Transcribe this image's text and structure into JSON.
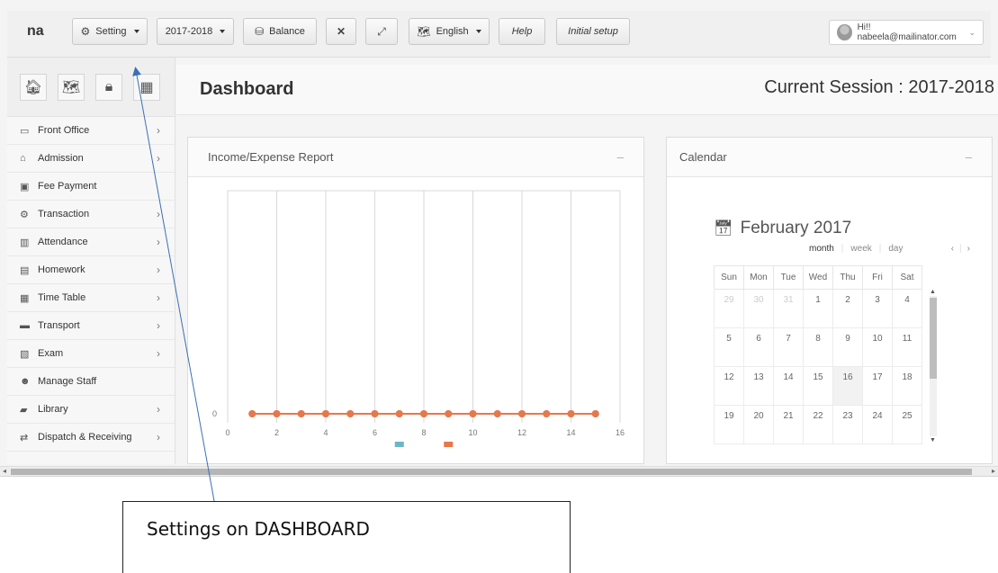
{
  "topbar": {
    "brand": "na",
    "setting_label": "Setting",
    "session_label": "2017-2018",
    "balance_label": "Balance",
    "language_label": "English",
    "help_label": "Help",
    "initial_setup_label": "Initial setup",
    "user_label": "Hi!! nabeela@mailinator.com"
  },
  "sidebar": {
    "items": [
      {
        "label": "Front Office",
        "icon": "monitor-icon"
      },
      {
        "label": "Admission",
        "icon": "graduation-cap-icon"
      },
      {
        "label": "Fee Payment",
        "icon": "money-icon"
      },
      {
        "label": "Transaction",
        "icon": "gear-icon"
      },
      {
        "label": "Attendance",
        "icon": "bar-chart-icon"
      },
      {
        "label": "Homework",
        "icon": "file-icon"
      },
      {
        "label": "Time Table",
        "icon": "calendar-icon"
      },
      {
        "label": "Transport",
        "icon": "bus-icon"
      },
      {
        "label": "Exam",
        "icon": "document-icon"
      },
      {
        "label": "Manage Staff",
        "icon": "users-icon"
      },
      {
        "label": "Library",
        "icon": "book-icon"
      },
      {
        "label": "Dispatch & Receiving",
        "icon": "exchange-icon"
      }
    ]
  },
  "header": {
    "title": "Dashboard",
    "session": "Current Session : 2017-2018"
  },
  "report_panel": {
    "title": "Income/Expense Report",
    "minimize": "–"
  },
  "chart_data": {
    "type": "line",
    "x": [
      1,
      2,
      3,
      4,
      5,
      6,
      7,
      8,
      9,
      10,
      11,
      12,
      13,
      14,
      15
    ],
    "series": [
      {
        "values": [
          0,
          0,
          0,
          0,
          0,
          0,
          0,
          0,
          0,
          0,
          0,
          0,
          0,
          0,
          0
        ],
        "color": "#6bb7c9"
      },
      {
        "values": [
          0,
          0,
          0,
          0,
          0,
          0,
          0,
          0,
          0,
          0,
          0,
          0,
          0,
          0,
          0
        ],
        "color": "#e8774a"
      }
    ],
    "xlim": [
      0,
      16
    ],
    "xticks": [
      "0",
      "2",
      "4",
      "6",
      "8",
      "10",
      "12",
      "14",
      "16"
    ],
    "yticks": [
      "0"
    ],
    "grid": "vertical",
    "legend": "bottom"
  },
  "calendar_panel": {
    "title": "Calendar",
    "minimize": "–",
    "month_title": "February 2017",
    "views": [
      "month",
      "week",
      "day"
    ],
    "nav": [
      "‹",
      "›"
    ],
    "weekdays": [
      "Sun",
      "Mon",
      "Tue",
      "Wed",
      "Thu",
      "Fri",
      "Sat"
    ],
    "weeks": [
      [
        "29",
        "30",
        "31",
        "1",
        "2",
        "3",
        "4"
      ],
      [
        "5",
        "6",
        "7",
        "8",
        "9",
        "10",
        "11"
      ],
      [
        "12",
        "13",
        "14",
        "15",
        "16",
        "17",
        "18"
      ],
      [
        "19",
        "20",
        "21",
        "22",
        "23",
        "24",
        "25"
      ]
    ]
  },
  "annotation": {
    "text": "Settings on DASHBOARD"
  }
}
